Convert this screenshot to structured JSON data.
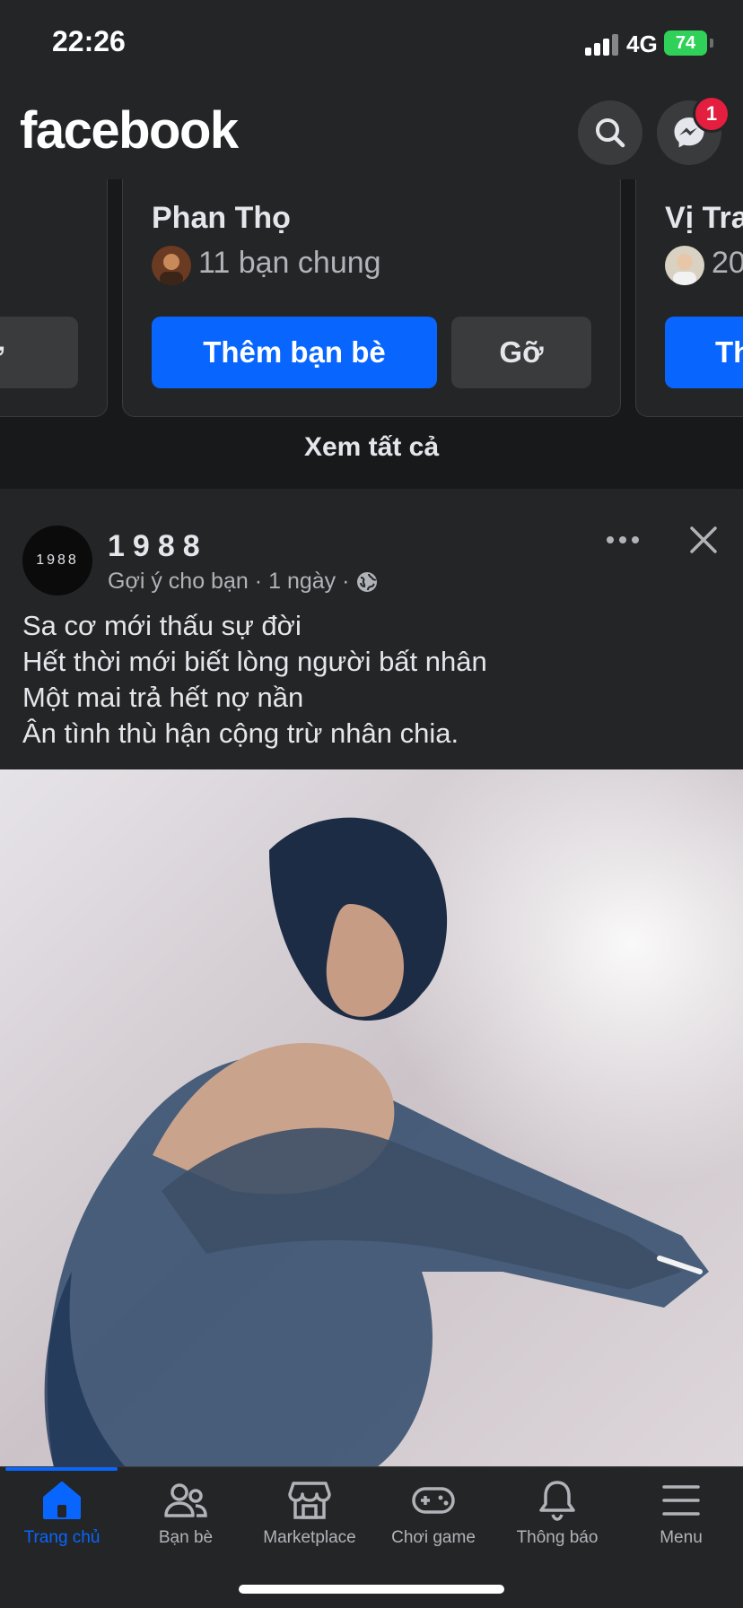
{
  "status_bar": {
    "time": "22:26",
    "network": "4G",
    "battery": "74"
  },
  "header": {
    "logo": "facebook",
    "messenger_badge": "1"
  },
  "people_you_may_know": {
    "left_card": {
      "remove_label": "Gỡ"
    },
    "main_card": {
      "name": "Phan Thọ",
      "mutual": "11 bạn chung",
      "add_label": "Thêm bạn bè",
      "remove_label": "Gỡ"
    },
    "right_card": {
      "name": "Vị Tra",
      "mutual": "20",
      "add_label": "Th"
    },
    "see_all": "Xem tất cả"
  },
  "post": {
    "page_name": "1988",
    "avatar_text": "1988",
    "suggestion": "Gợi ý cho bạn",
    "separator": "·",
    "time": "1 ngày",
    "lines": [
      "Sa cơ mới thấu sự đời",
      "Hết thời mới biết lòng người bất nhân",
      "Một mai trả hết nợ nần",
      "Ân tình thù hận cộng trừ nhân chia."
    ]
  },
  "tabbar": {
    "items": [
      {
        "label": "Trang chủ",
        "icon": "home-icon"
      },
      {
        "label": "Bạn bè",
        "icon": "friends-icon"
      },
      {
        "label": "Marketplace",
        "icon": "marketplace-icon"
      },
      {
        "label": "Chơi game",
        "icon": "gaming-icon"
      },
      {
        "label": "Thông báo",
        "icon": "bell-icon"
      },
      {
        "label": "Menu",
        "icon": "menu-icon"
      }
    ]
  },
  "colors": {
    "background": "#242526",
    "accent": "#0866ff",
    "badge": "#e41e3f",
    "battery": "#30d158"
  }
}
